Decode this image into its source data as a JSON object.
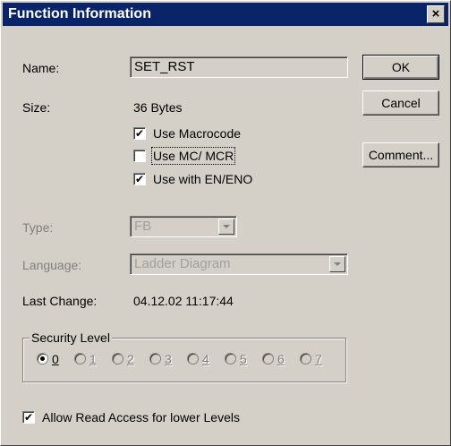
{
  "window": {
    "title": "Function Information",
    "close_label": "×"
  },
  "name": {
    "label": "Name:",
    "value": "SET_RST"
  },
  "size": {
    "label": "Size:",
    "value": "36 Bytes"
  },
  "options": {
    "use_macrocode": {
      "label": "Use Macrocode",
      "checked": true,
      "mark": "✔"
    },
    "use_mc_mcr": {
      "label": "Use MC/ MCR",
      "checked": false,
      "mark": ""
    },
    "use_en_eno": {
      "label": "Use with EN/ENO",
      "checked": true,
      "mark": "✔"
    }
  },
  "type": {
    "label": "Type:",
    "value": "FB"
  },
  "language": {
    "label": "Language:",
    "value": "Ladder Diagram"
  },
  "last_change": {
    "label": "Last Change:",
    "value": "04.12.02 11:17:44"
  },
  "security": {
    "title": "Security Level",
    "levels": [
      "0",
      "1",
      "2",
      "3",
      "4",
      "5",
      "6",
      "7"
    ],
    "selected": "0"
  },
  "read_access": {
    "label": "Allow Read Access for lower Levels",
    "checked": true,
    "mark": "✔"
  },
  "buttons": {
    "ok": "OK",
    "cancel": "Cancel",
    "comment": "Comment..."
  }
}
